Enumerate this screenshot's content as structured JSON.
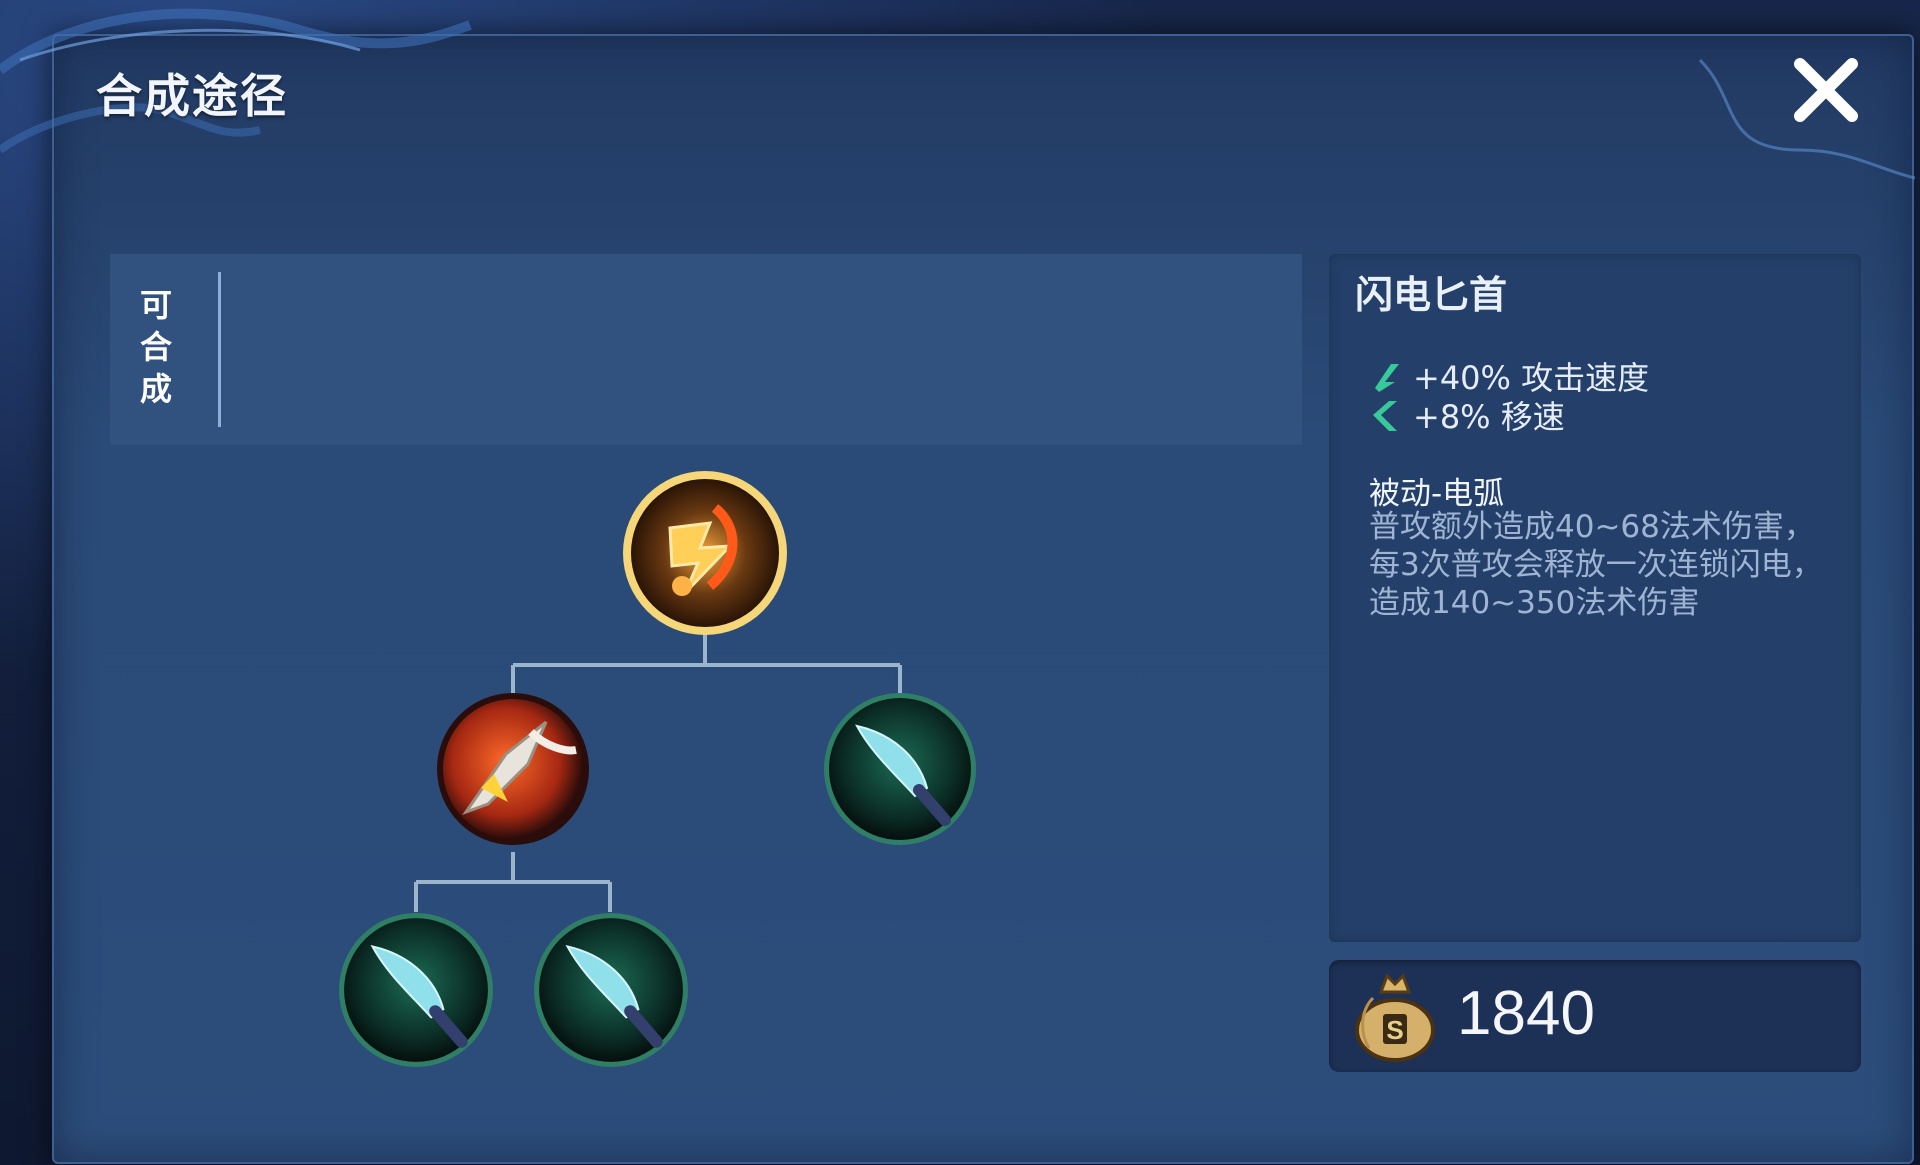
{
  "dialog": {
    "title": "合成途径",
    "close_icon": "close-icon"
  },
  "synth_section": {
    "label": "可合成",
    "label_chars": [
      "可",
      "合",
      "成"
    ]
  },
  "recipe_tree": {
    "root": {
      "icon": "lightning-dagger-item-icon",
      "tier": "gold"
    },
    "children": [
      {
        "icon": "spear-item-icon",
        "tier": "red"
      },
      {
        "icon": "dagger-item-icon",
        "tier": "green"
      }
    ],
    "grandchildren": [
      {
        "icon": "dagger-item-icon",
        "tier": "green"
      },
      {
        "icon": "dagger-item-icon",
        "tier": "green"
      }
    ]
  },
  "item": {
    "name": "闪电匕首",
    "stats": [
      {
        "icon": "attack-speed-icon",
        "text": "+40% 攻击速度"
      },
      {
        "icon": "move-speed-icon",
        "text": "+8% 移速"
      }
    ],
    "passive_title": "被动-电弧",
    "passive_desc": "普攻额外造成40~68法术伤害，每3次普攻会释放一次连锁闪电，造成140~350法术伤害"
  },
  "price": {
    "icon": "gold-bag-icon",
    "value": "1840"
  },
  "colors": {
    "accent_green": "#37c99a",
    "gold": "#f2c14e",
    "panel": "#24406a"
  }
}
